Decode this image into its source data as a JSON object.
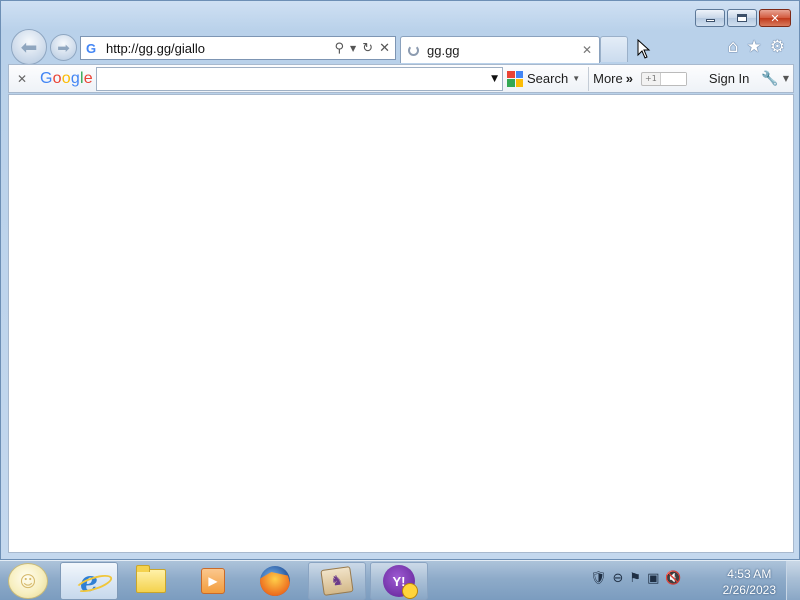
{
  "browser": {
    "address_url": "http://gg.gg/giallo",
    "tab_title": "gg.gg",
    "tab_loading": true
  },
  "google_toolbar": {
    "logo": "Google",
    "search_value": "",
    "search_button": "Search",
    "more_button": "More",
    "plusone_label": "+1",
    "sign_in": "Sign In"
  },
  "taskbar": {
    "apps": [
      "Internet Explorer",
      "Windows Explorer",
      "Windows Media Player",
      "Firefox",
      "Game",
      "Yahoo Messenger"
    ],
    "clock_time": "4:53 AM",
    "clock_date": "2/26/2023"
  },
  "icons": {
    "back": "back-arrow-icon",
    "forward": "forward-arrow-icon",
    "search": "magnifier-icon",
    "refresh": "refresh-icon",
    "stop": "close-icon",
    "home": "home-icon",
    "favorites": "star-icon",
    "tools": "gear-icon"
  },
  "colors": {
    "frame": "#b9d1ea",
    "google_blue": "#4285f4",
    "google_red": "#ea4335",
    "google_yellow": "#fbbc05",
    "google_green": "#34a853"
  }
}
